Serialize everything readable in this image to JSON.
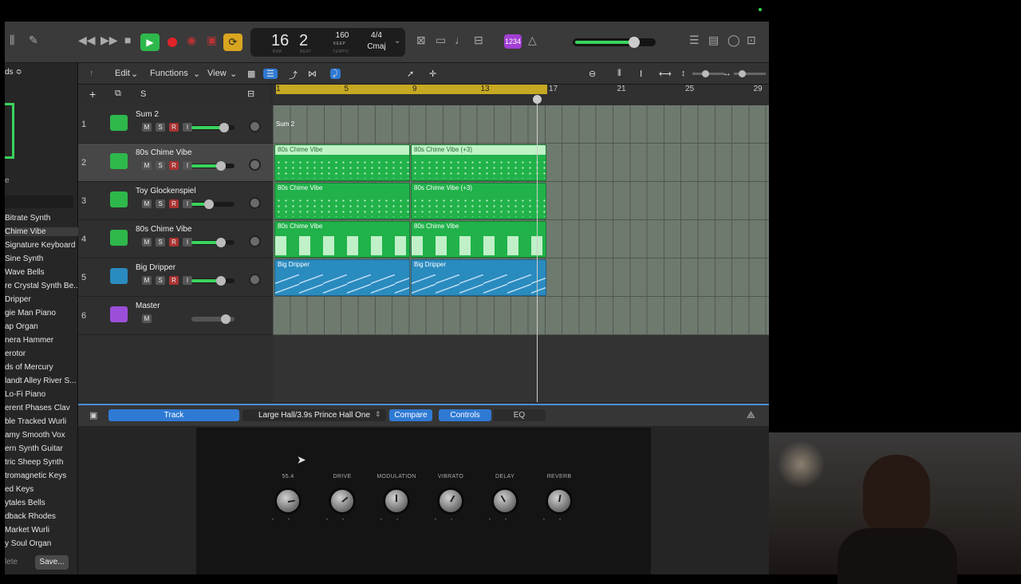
{
  "toolbar": {
    "lcd": {
      "bar": "16",
      "beat": "2",
      "bar_label": "BAR",
      "beat_label": "BEAT",
      "tempo": "160",
      "tempo_mode": "KEEP",
      "tempo_label": "TEMPO",
      "signature": "4/4",
      "key": "Cmaj"
    },
    "badge": "1234"
  },
  "arrange_menu": {
    "edit": "Edit",
    "functions": "Functions",
    "view": "View"
  },
  "track_controls": {
    "solo": "S"
  },
  "ruler": {
    "marks": [
      "1",
      "5",
      "9",
      "13",
      "17",
      "21",
      "25",
      "29"
    ]
  },
  "library": {
    "header": "ds ≎",
    "items": [
      "Bitrate Synth",
      "Chime Vibe",
      "Signature Keyboard",
      "Sine Synth",
      "Wave Bells",
      "re Crystal Synth Be...",
      "Dripper",
      "gie Man Piano",
      "ap Organ",
      "nera Hammer",
      "erotor",
      "ds of Mercury",
      "landt Alley River S...",
      "Lo-Fi Piano",
      "erent Phases Clav",
      "ble Tracked Wurli",
      "amy Smooth Vox",
      "ern Synth Guitar",
      "tric Sheep Synth",
      "tromagnetic Keys",
      "ed Keys",
      "ytales Bells",
      "dback Rhodes",
      "Market Wurli",
      "y Soul Organ"
    ],
    "side_label": "e",
    "delete": "lete",
    "save": "Save..."
  },
  "tracks": [
    {
      "num": "1",
      "name": "Sum 2",
      "buttons": [
        "M",
        "S",
        "R",
        "I"
      ],
      "color": "#2eb84b",
      "volume": 0.75
    },
    {
      "num": "2",
      "name": "80s Chime Vibe",
      "buttons": [
        "M",
        "S",
        "R",
        "I"
      ],
      "color": "#2eb84b",
      "volume": 0.68
    },
    {
      "num": "3",
      "name": "Toy Glockenspiel",
      "buttons": [
        "M",
        "S",
        "R",
        "I"
      ],
      "color": "#2eb84b",
      "volume": 0.4
    },
    {
      "num": "4",
      "name": "80s Chime Vibe",
      "buttons": [
        "M",
        "S",
        "R",
        "I"
      ],
      "color": "#2eb84b",
      "volume": 0.68
    },
    {
      "num": "5",
      "name": "Big Dripper",
      "buttons": [
        "M",
        "S",
        "R",
        "I"
      ],
      "color": "#2a8bbf",
      "volume": 0.68
    },
    {
      "num": "6",
      "name": "Master",
      "buttons": [
        "M"
      ],
      "color": "#9b4fd8",
      "volume": 0.8
    }
  ],
  "regions": {
    "sum": "Sum 2",
    "lane2": [
      "80s Chime Vibe",
      "80s Chime Vibe (+3)"
    ],
    "lane3": [
      "80s Chime Vibe",
      "80s Chime Vibe (+3)"
    ],
    "lane4": [
      "80s Chime Vibe",
      "80s Chime Vibe"
    ],
    "lane5": [
      "Big Dripper",
      "Big Dripper"
    ]
  },
  "editor": {
    "track_tab": "Track",
    "preset": "Large Hall/3.9s Prince Hall One",
    "compare": "Compare",
    "controls": "Controls",
    "eq": "EQ",
    "knobs": [
      {
        "label": "55.4",
        "angle": -10
      },
      {
        "label": "DRIVE",
        "angle": -40
      },
      {
        "label": "MODULATION",
        "angle": -90
      },
      {
        "label": "VIBRATO",
        "angle": -60
      },
      {
        "label": "DELAY",
        "angle": -120
      },
      {
        "label": "REVERB",
        "angle": -80
      }
    ]
  },
  "colors": {
    "accent": "#2f7ad4",
    "green": "#21b24a",
    "blue": "#2a8bbf",
    "cycle": "#c6a823"
  }
}
